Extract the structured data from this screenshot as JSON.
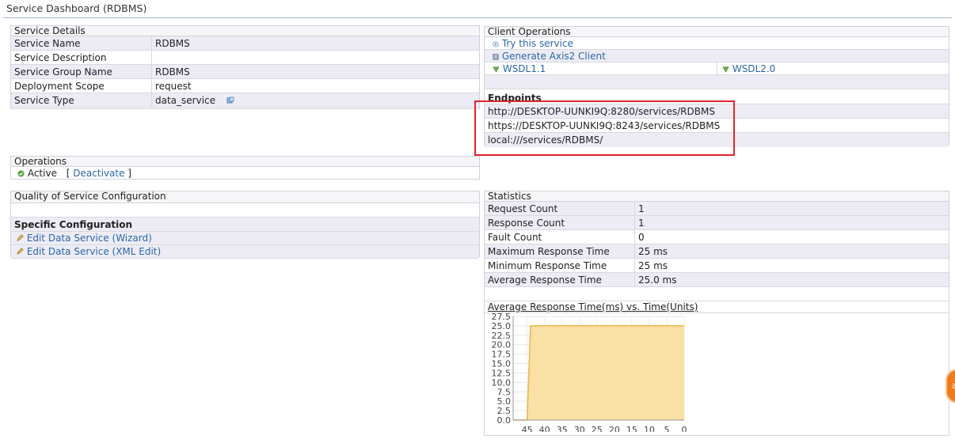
{
  "page": {
    "title": "Service Dashboard (RDBMS)"
  },
  "service_details": {
    "header": "Service Details",
    "rows": [
      {
        "label": "Service Name",
        "value": "RDBMS"
      },
      {
        "label": "Service Description",
        "value": ""
      },
      {
        "label": "Service Group Name",
        "value": "RDBMS"
      },
      {
        "label": "Deployment Scope",
        "value": "request"
      },
      {
        "label": "Service Type",
        "value": "data_service",
        "icon": "edit-icon"
      }
    ]
  },
  "operations": {
    "header": "Operations",
    "status_label": "Active",
    "bracket_open": "[",
    "deactivate_label": "Deactivate",
    "bracket_close": "]",
    "status_icon": "check-circle-icon"
  },
  "qos": {
    "header": "Quality of Service Configuration",
    "specific_header": "Specific Configuration",
    "links": [
      {
        "label": "Edit Data Service (Wizard)",
        "icon": "pencil-icon"
      },
      {
        "label": "Edit Data Service (XML Edit)",
        "icon": "pencil-icon"
      }
    ]
  },
  "client_ops": {
    "header": "Client Operations",
    "try_label": "Try this service",
    "generate_label": "Generate Axis2 Client",
    "wsdl1_label": "WSDL1.1",
    "wsdl2_label": "WSDL2.0",
    "endpoints_header": "Endpoints",
    "endpoints": [
      "http://DESKTOP-UUNKI9Q:8280/services/RDBMS",
      "https://DESKTOP-UUNKI9Q:8243/services/RDBMS",
      "local:///services/RDBMS/"
    ]
  },
  "statistics": {
    "header": "Statistics",
    "rows": [
      {
        "label": "Request Count",
        "value": "1"
      },
      {
        "label": "Response Count",
        "value": "1"
      },
      {
        "label": "Fault Count",
        "value": "0"
      },
      {
        "label": "Maximum Response Time",
        "value": "25 ms"
      },
      {
        "label": "Minimum Response Time",
        "value": "25 ms"
      },
      {
        "label": "Average Response Time",
        "value": "25.0 ms"
      }
    ]
  },
  "chart_data": {
    "type": "area",
    "title": "Average Response Time(ms) vs. Time(Units)",
    "xlabel": "",
    "ylabel": "",
    "x_ticks": [
      "45",
      "40",
      "35",
      "30",
      "25",
      "20",
      "15",
      "10",
      "5",
      "0"
    ],
    "y_ticks": [
      "27.5",
      "25.0",
      "22.5",
      "20.0",
      "17.5",
      "15.0",
      "12.5",
      "10.0",
      "7.5",
      "5.0",
      "2.5",
      "0.0"
    ],
    "xlim": [
      49,
      0
    ],
    "ylim": [
      0,
      27.5
    ],
    "series": [
      {
        "x": [
          49,
          45,
          44,
          0
        ],
        "y": [
          0,
          0,
          25,
          25
        ]
      }
    ],
    "fill_color": "#f9e0a4",
    "line_color": "#e8b64a",
    "grid": true
  },
  "colors": {
    "link": "#2b67a8",
    "highlight": "#e0252a",
    "row_alt": "#edecf5",
    "float_button": "#f07b1c"
  }
}
